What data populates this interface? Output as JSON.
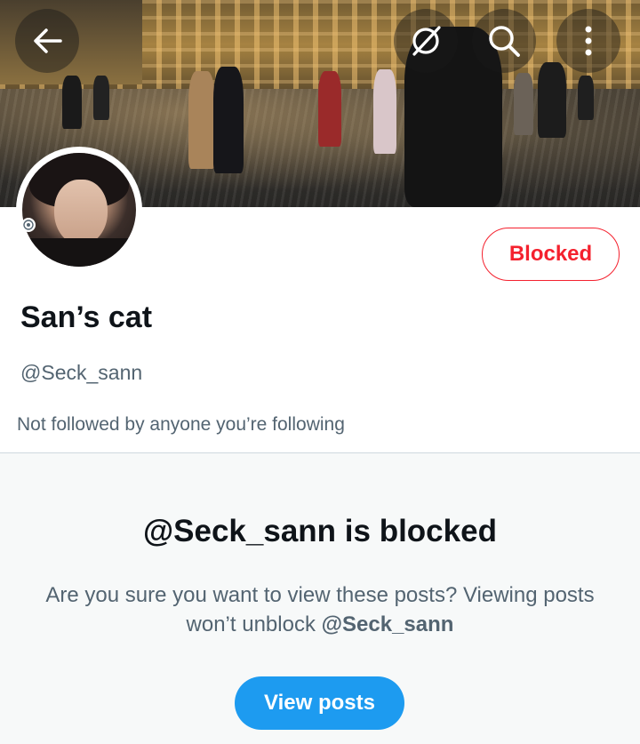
{
  "header": {
    "back_icon": "arrow-left-icon",
    "grok_icon": "slashed-circle-icon",
    "search_icon": "search-icon",
    "more_icon": "more-vertical-icon"
  },
  "profile": {
    "display_name": "San’s cat",
    "handle": "@Seck_sann",
    "followers_note": "Not followed by anyone you’re following",
    "blocked_button_label": "Blocked"
  },
  "blocked_notice": {
    "title": "@Seck_sann is blocked",
    "description_prefix": "Are you sure you want to view these posts? Viewing posts won’t unblock ",
    "description_handle": "@Seck_sann",
    "view_posts_label": "View posts"
  },
  "colors": {
    "accent_blue": "#1d9bf0",
    "blocked_red": "#f4212e",
    "text_primary": "#0f1419",
    "text_secondary": "#536471",
    "panel_bg": "#f7f9f9"
  }
}
